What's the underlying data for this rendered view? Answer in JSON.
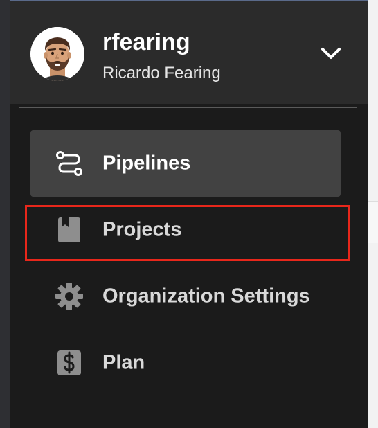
{
  "account": {
    "username": "rfearing",
    "full_name": "Ricardo Fearing",
    "dropdown_icon": "chevron-down-icon",
    "avatar_icon": "avatar-illustration"
  },
  "nav": {
    "items": [
      {
        "label": "Pipelines",
        "icon": "pipelines-icon",
        "active": true
      },
      {
        "label": "Projects",
        "icon": "book-icon",
        "active": false,
        "highlighted": true
      },
      {
        "label": "Organization Settings",
        "icon": "gear-icon",
        "active": false
      },
      {
        "label": "Plan",
        "icon": "dollar-icon",
        "active": false
      }
    ]
  },
  "colors": {
    "panel_bg": "#1b1b1b",
    "header_bg": "#2b2b2b",
    "active_bg": "#424242",
    "highlight_border": "#e8271b",
    "text_primary": "#ffffff",
    "text_secondary": "#d9d9d9"
  }
}
